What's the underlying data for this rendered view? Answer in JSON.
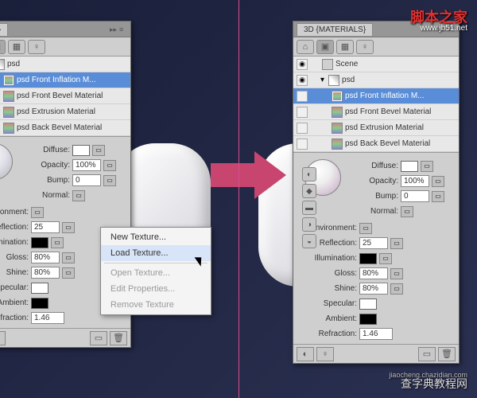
{
  "panel_title": "3D {MATERIALS}",
  "scene": {
    "root": "Scene",
    "object": "psd",
    "materials": [
      "psd Front Inflation M...",
      "psd Front Bevel Material",
      "psd Extrusion Material",
      "psd Back Bevel Material"
    ]
  },
  "props": {
    "diffuse": {
      "label": "Diffuse:"
    },
    "opacity": {
      "label": "Opacity:",
      "value": "100%"
    },
    "bump": {
      "label": "Bump:",
      "value": "0"
    },
    "normal": {
      "label": "Normal:"
    },
    "environment": {
      "label": "Environment:"
    },
    "reflection": {
      "label": "Reflection:",
      "value": "25"
    },
    "illumination": {
      "label": "Illumination:"
    },
    "gloss": {
      "label": "Gloss:",
      "value": "80%"
    },
    "shine": {
      "label": "Shine:",
      "value": "80%"
    },
    "specular": {
      "label": "Specular:"
    },
    "ambient": {
      "label": "Ambient:"
    },
    "refraction": {
      "label": "Refraction:",
      "value": "1.46"
    }
  },
  "menu": {
    "new": "New Texture...",
    "load": "Load Texture...",
    "open": "Open Texture...",
    "edit": "Edit Properties...",
    "remove": "Remove Texture"
  },
  "watermark": {
    "top": "脚本之家",
    "top_sub": "www.jb51.net",
    "bot": "查字典教程网",
    "bot_sub": "jiaocheng.chazidian.com"
  },
  "icons": {
    "eye": "◉",
    "expand": "▸",
    "collapse": "▾",
    "menu": "≡",
    "close": "▸▸",
    "filter": "⌂",
    "cube": "▣",
    "mesh": "▦",
    "light": "♀",
    "bulb": "◐",
    "trash": "🗑",
    "doc": "▭"
  }
}
